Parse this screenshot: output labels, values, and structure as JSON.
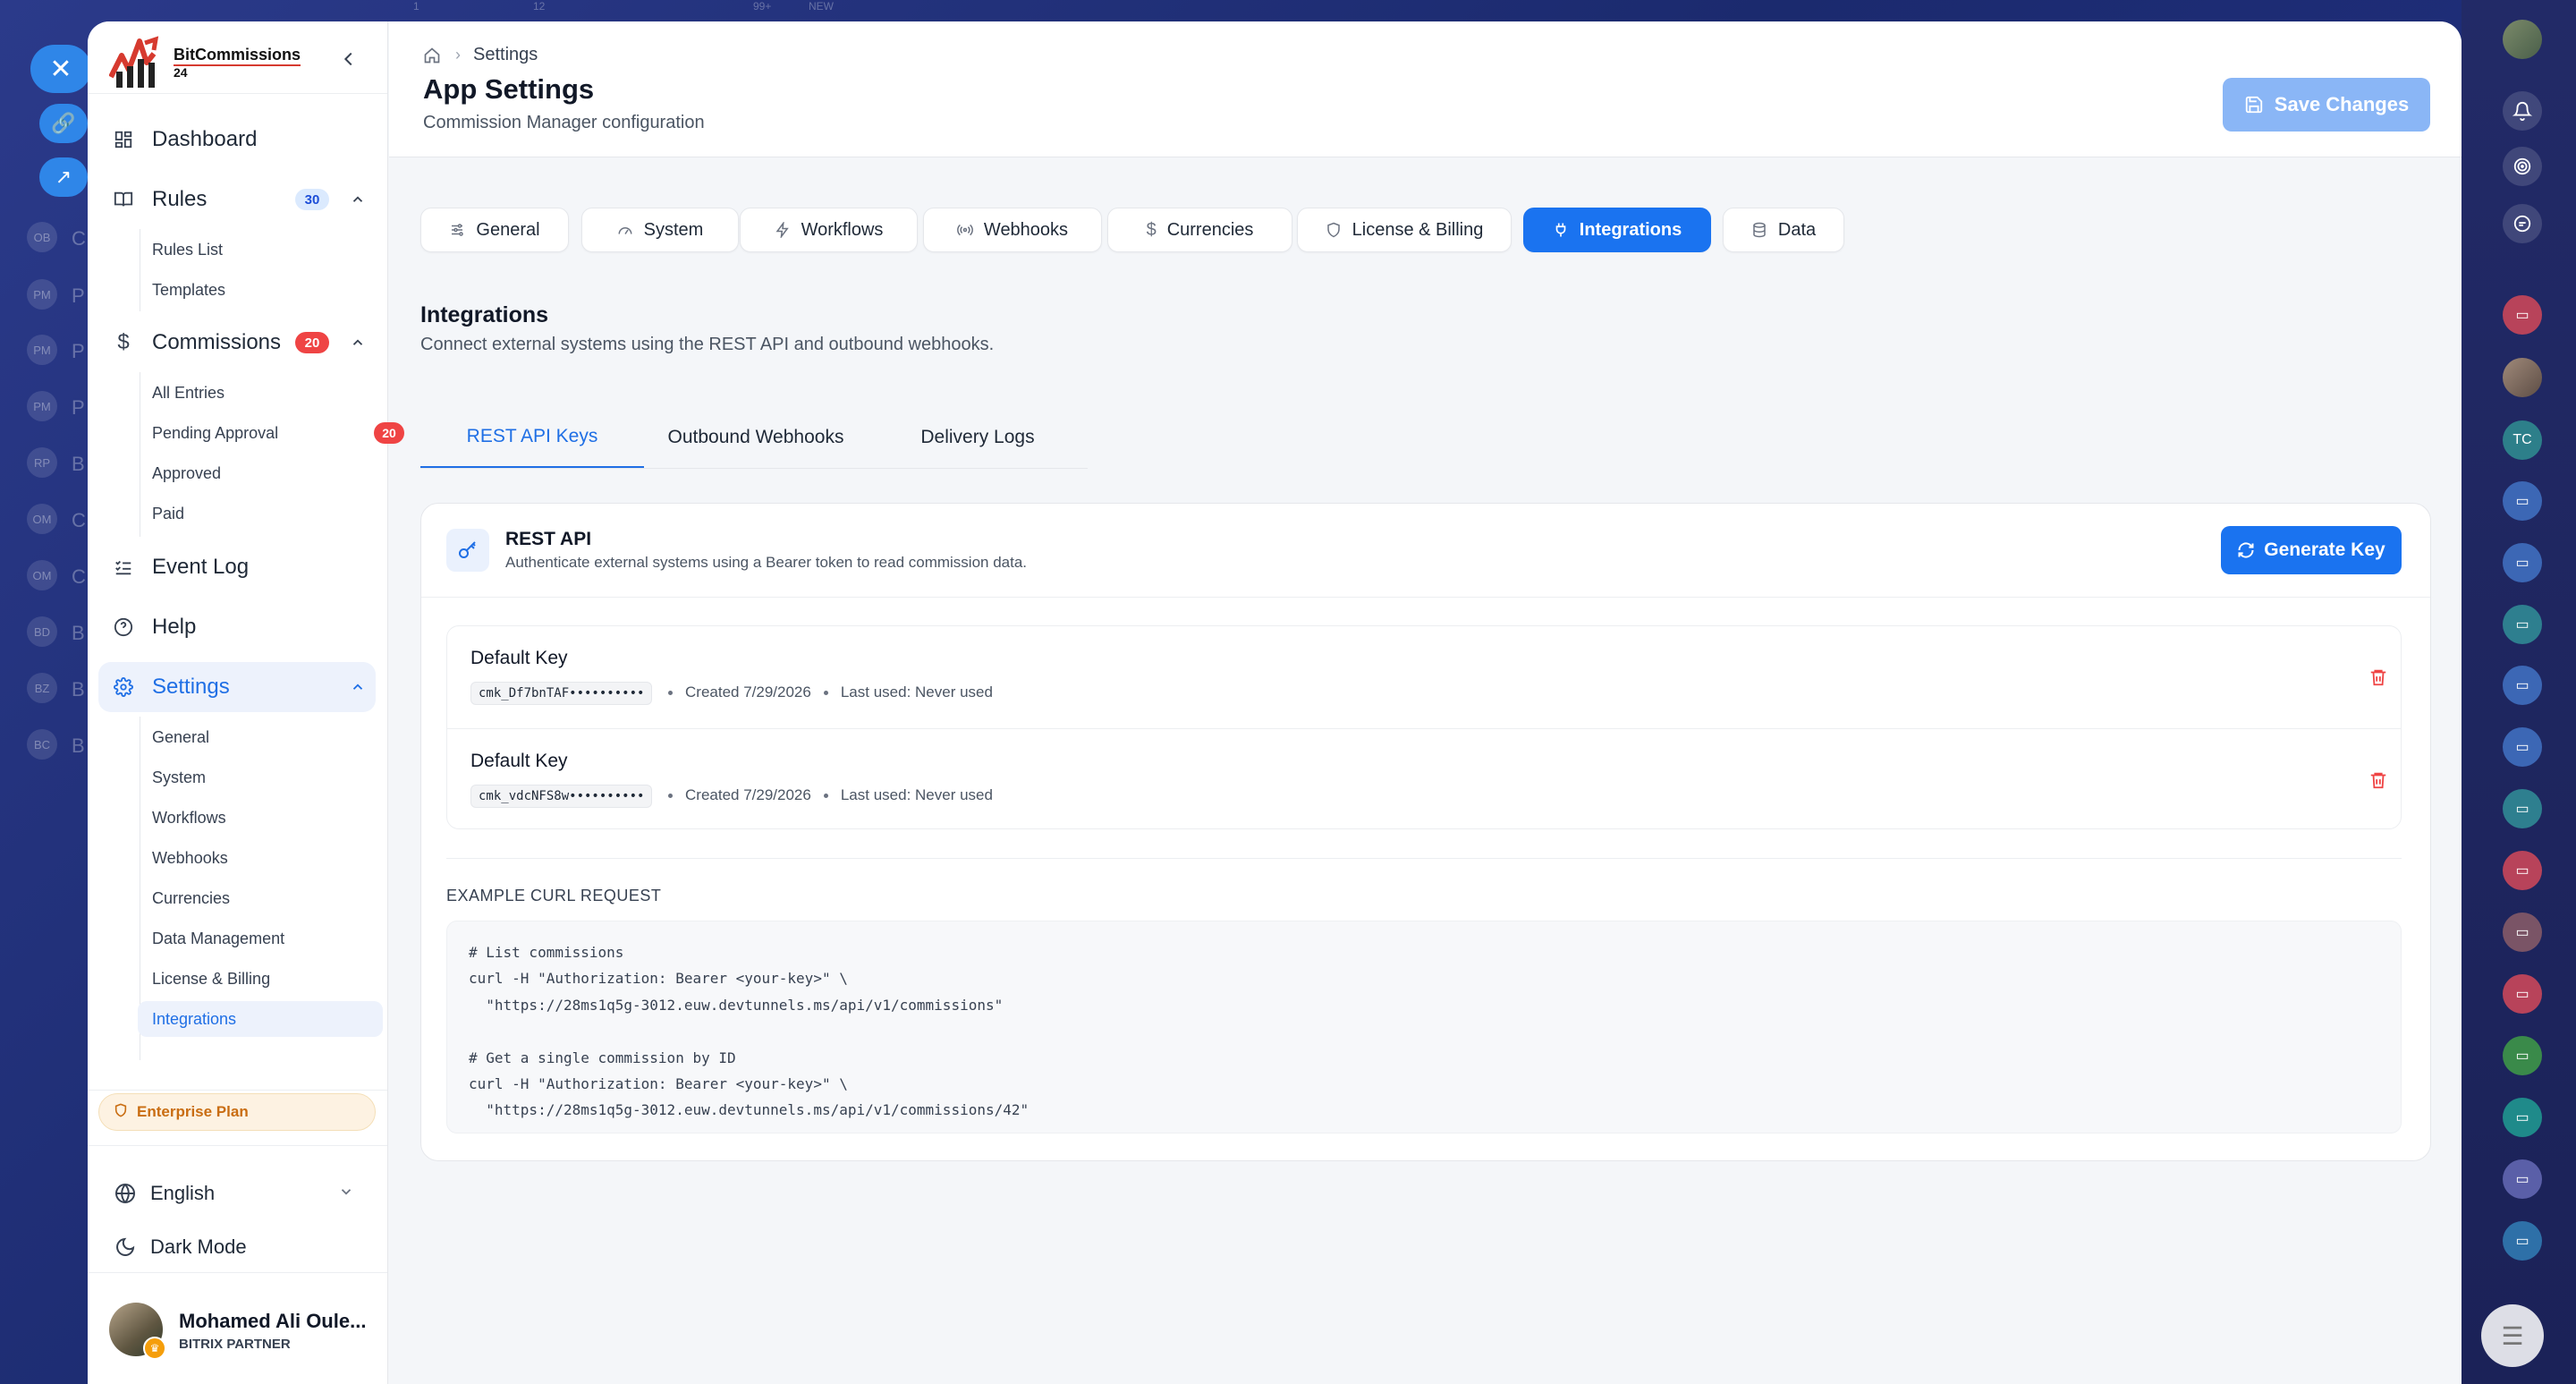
{
  "backdrop": {
    "left_rows": [
      "OB",
      "PM",
      "PM",
      "PM",
      "RP",
      "OM",
      "OM",
      "BD",
      "BZ",
      "BC"
    ],
    "left_row_letters": [
      "C",
      "P",
      "P",
      "P",
      "B",
      "C",
      "C",
      "B",
      "B",
      "B"
    ],
    "top_badges": [
      "1",
      "12",
      "99+",
      "NEW"
    ]
  },
  "rail": {
    "items": [
      "avatar",
      "bell-icon",
      "target-icon",
      "chat-icon",
      "video-icon",
      "avatar",
      "TC",
      "video-icon",
      "video-icon",
      "video-icon",
      "video-icon",
      "video-icon",
      "video-icon",
      "video-icon",
      "video-icon",
      "video-icon",
      "video-icon",
      "video-icon",
      "video-icon",
      "video-icon"
    ],
    "tc_label": "TC"
  },
  "brand": {
    "name": "BitCommissions",
    "number": "24"
  },
  "sidebar": {
    "dashboard": "Dashboard",
    "rules": {
      "label": "Rules",
      "badge": "30",
      "items": [
        "Rules List",
        "Templates"
      ]
    },
    "commissions": {
      "label": "Commissions",
      "badge": "20",
      "items": [
        "All Entries",
        "Pending Approval",
        "Approved",
        "Paid"
      ],
      "pending_badge": "20"
    },
    "event_log": "Event Log",
    "help": "Help",
    "settings": {
      "label": "Settings",
      "items": [
        "General",
        "System",
        "Workflows",
        "Webhooks",
        "Currencies",
        "Data Management",
        "License & Billing",
        "Integrations"
      ]
    },
    "plan": "Enterprise Plan",
    "language": "English",
    "dark_mode": "Dark Mode",
    "user": {
      "name": "Mohamed Ali Oule...",
      "role": "BITRIX PARTNER"
    }
  },
  "header": {
    "breadcrumb": "Settings",
    "title": "App Settings",
    "subtitle": "Commission Manager configuration",
    "save_label": "Save Changes"
  },
  "tabs": [
    "General",
    "System",
    "Workflows",
    "Webhooks",
    "Currencies",
    "License & Billing",
    "Integrations",
    "Data"
  ],
  "section": {
    "title": "Integrations",
    "subtitle": "Connect external systems using the REST API and outbound webhooks."
  },
  "subtabs": [
    "REST API Keys",
    "Outbound Webhooks",
    "Delivery Logs"
  ],
  "card": {
    "title": "REST API",
    "subtitle": "Authenticate external systems using a Bearer token to read commission data.",
    "generate_label": "Generate Key",
    "keys": [
      {
        "name": "Default Key",
        "code": "cmk_Df7bnTAF••••••••••",
        "created": "Created 7/29/2026",
        "last_used": "Last used: Never used"
      },
      {
        "name": "Default Key",
        "code": "cmk_vdcNFS8w••••••••••",
        "created": "Created 7/29/2026",
        "last_used": "Last used: Never used"
      }
    ],
    "example_label": "EXAMPLE CURL REQUEST",
    "example_code": "# List commissions\ncurl -H \"Authorization: Bearer <your-key>\" \\\n  \"https://28ms1q5g-3012.euw.devtunnels.ms/api/v1/commissions\"\n\n# Get a single commission by ID\ncurl -H \"Authorization: Bearer <your-key>\" \\\n  \"https://28ms1q5g-3012.euw.devtunnels.ms/api/v1/commissions/42\""
  }
}
